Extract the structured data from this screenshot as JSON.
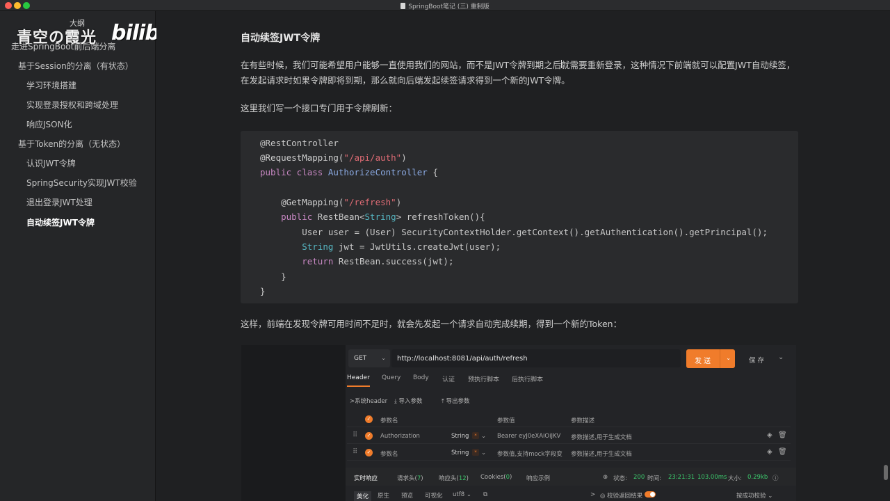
{
  "window": {
    "title": "SpringBoot笔记 (三) 重制版"
  },
  "sidebar": {
    "watermark": "青空の霞光",
    "bili_logo": "bilibili",
    "outline_label": "大纲",
    "root": "走进SpringBoot前后端分离",
    "items": [
      {
        "label": "基于Session的分离（有状态）",
        "level": 1
      },
      {
        "label": "学习环境搭建",
        "level": 2
      },
      {
        "label": "实现登录授权和跨域处理",
        "level": 2
      },
      {
        "label": "响应JSON化",
        "level": 2
      },
      {
        "label": "基于Token的分离（无状态）",
        "level": 1
      },
      {
        "label": "认识JWT令牌",
        "level": 2
      },
      {
        "label": "SpringSecurity实现JWT校验",
        "level": 2
      },
      {
        "label": "退出登录JWT处理",
        "level": 2
      },
      {
        "label": "自动续签JWT令牌",
        "level": 2,
        "active": true
      }
    ]
  },
  "content": {
    "heading": "自动续签JWT令牌",
    "para1": "在有些时候，我们可能希望用户能够一直使用我们的网站，而不是JWT令牌到期之后就需要重新登录，这种情况下前端就可以配置JWT自动续签，在发起请求时如果令牌即将到期，那么就向后端发起续签请求得到一个新的JWT令牌。",
    "para2": "这里我们写一个接口专门用于令牌刷新：",
    "para3": "这样，前端在发现令牌可用时间不足时，就会先发起一个请求自动完成续期，得到一个新的Token：",
    "code": {
      "l1": "@RestController",
      "l2a": "@RequestMapping(",
      "l2b": "\"/api/auth\"",
      "l2c": ")",
      "l3a": "public class ",
      "l3b": "AuthorizeController",
      "l3c": " {",
      "l5a": "    @GetMapping(",
      "l5b": "\"/refresh\"",
      "l5c": ")",
      "l6a": "    public ",
      "l6b": "RestBean<",
      "l6c": "String",
      "l6d": "> refreshToken(){",
      "l7": "        User user = (User) SecurityContextHolder.getContext().getAuthentication().getPrincipal();",
      "l8a": "        ",
      "l8b": "String",
      "l8c": " jwt = JwtUtils.createJwt(user);",
      "l9a": "        ",
      "l9b": "return",
      "l9c": " RestBean.success(jwt);",
      "l10": "    }",
      "l11": "}"
    }
  },
  "api_tool": {
    "method": "GET",
    "url": "http://localhost:8081/api/auth/refresh",
    "send": "发 送",
    "save": "保 存",
    "tabs": [
      "Header",
      "Query",
      "Body",
      "认证",
      "预执行脚本",
      "后执行脚本"
    ],
    "sub_actions": [
      "系统header",
      "导入参数",
      "导出参数"
    ],
    "table_header": {
      "name": "参数名",
      "value": "参数值",
      "desc": "参数描述"
    },
    "rows": [
      {
        "name": "Authorization",
        "type": "String",
        "value": "Bearer eyJ0eXAiOiJKV",
        "desc": "参数描述,用于生成文档"
      },
      {
        "name": "参数名",
        "type": "String",
        "value": "参数值,支持mock字段变",
        "desc": "参数描述,用于生成文档"
      }
    ],
    "response_tabs": [
      "实时响应",
      "请求头(7)",
      "响应头(12)",
      "Cookies(0)",
      "响应示例"
    ],
    "status_label": "状态:",
    "status": "200",
    "time_label": "时间:",
    "time": "23:21:31",
    "duration": "103.00ms",
    "size_label": "大小:",
    "size": "0.29kb",
    "view_tabs": [
      "美化",
      "原生",
      "预览",
      "可视化"
    ],
    "encoding": "utf8",
    "verify_label": "校验返回结果",
    "verify_mode": "按成功校验"
  }
}
